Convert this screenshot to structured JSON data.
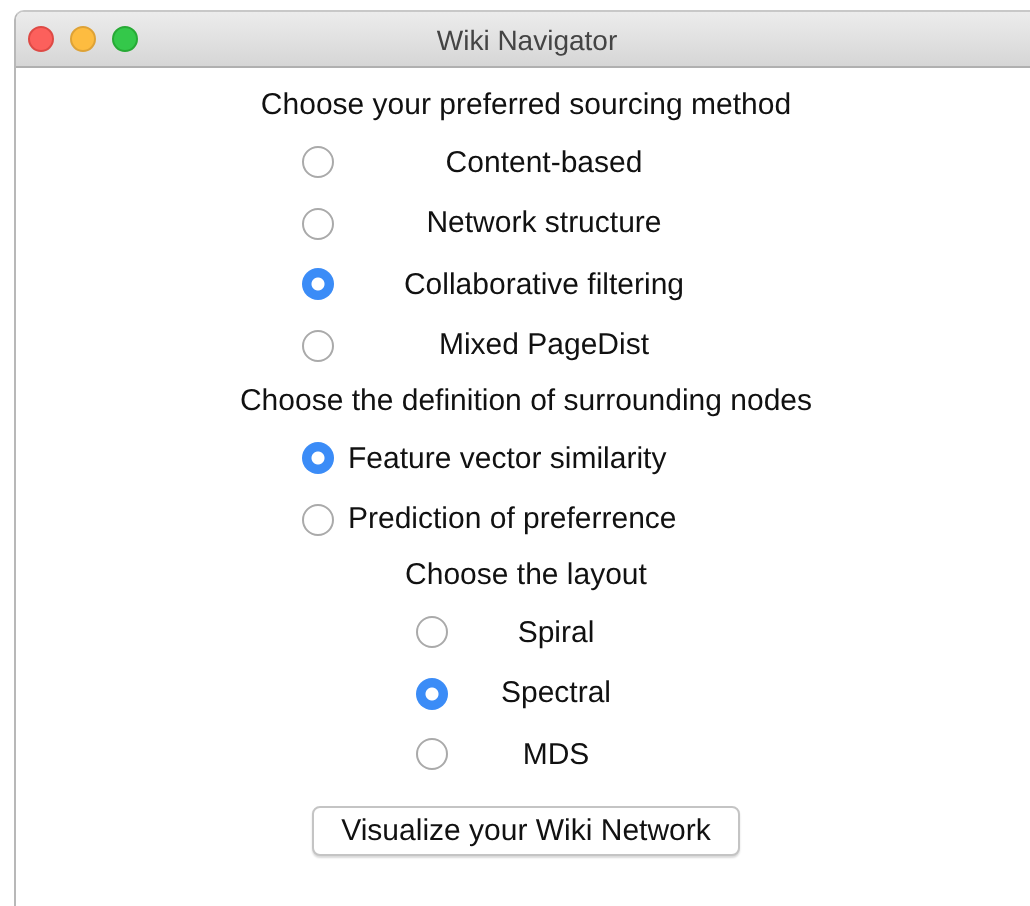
{
  "window": {
    "title": "Wiki Navigator"
  },
  "groups": [
    {
      "heading": "Choose your preferred sourcing method",
      "options": [
        {
          "label": "Content-based",
          "selected": false
        },
        {
          "label": "Network structure",
          "selected": false
        },
        {
          "label": "Collaborative filtering",
          "selected": true
        },
        {
          "label": "Mixed PageDist",
          "selected": false
        }
      ]
    },
    {
      "heading": "Choose the definition of surrounding nodes",
      "options": [
        {
          "label": "Feature vector similarity",
          "selected": true
        },
        {
          "label": "Prediction of preferrence",
          "selected": false
        }
      ]
    },
    {
      "heading": "Choose the layout",
      "options": [
        {
          "label": "Spiral",
          "selected": false
        },
        {
          "label": "Spectral",
          "selected": true
        },
        {
          "label": "MDS",
          "selected": false
        }
      ]
    }
  ],
  "button": "Visualize your Wiki Network"
}
